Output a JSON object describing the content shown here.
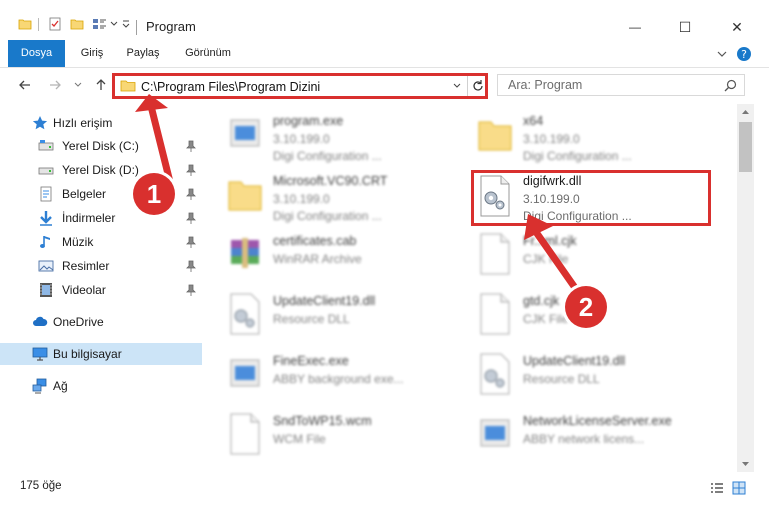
{
  "window": {
    "title": "Program",
    "minimize": "—",
    "maximize": "☐",
    "close": "✕"
  },
  "ribbon": {
    "tabs": [
      "Dosya",
      "Giriş",
      "Paylaş",
      "Görünüm"
    ]
  },
  "address": {
    "path": "C:\\Program Files\\Program Dizini",
    "search_placeholder": "Ara: Program"
  },
  "nav": {
    "quick_access": "Hızlı erişim",
    "items": [
      {
        "label": "Yerel Disk (C:)",
        "icon": "drive-icon",
        "pinned": true
      },
      {
        "label": "Yerel Disk (D:)",
        "icon": "drive-icon",
        "pinned": true
      },
      {
        "label": "Belgeler",
        "icon": "documents-icon",
        "pinned": true
      },
      {
        "label": "İndirmeler",
        "icon": "download-icon",
        "pinned": true
      },
      {
        "label": "Müzik",
        "icon": "music-icon",
        "pinned": true
      },
      {
        "label": "Resimler",
        "icon": "pictures-icon",
        "pinned": true
      },
      {
        "label": "Videolar",
        "icon": "videos-icon",
        "pinned": true
      }
    ],
    "onedrive": "OneDrive",
    "this_pc": "Bu bilgisayar",
    "network": "Ağ"
  },
  "files": [
    {
      "name": "program.exe",
      "line2": "3.10.199.0",
      "line3": "Digi Configuration ...",
      "icon": "exe-icon"
    },
    {
      "name": "x64",
      "line2": "3.10.199.0",
      "line3": "Digi Configuration ...",
      "icon": "folder-icon"
    },
    {
      "name": "Microsoft.VC90.CRT",
      "line2": "3.10.199.0",
      "line3": "Digi Configuration ...",
      "icon": "folder-icon"
    },
    {
      "name": "digifwrk.dll",
      "line2": "3.10.199.0",
      "line3": "Digi Configuration ...",
      "icon": "dll-gear-icon"
    },
    {
      "name": "certificates.cab",
      "line2": "WinRAR Archive",
      "line3": "",
      "icon": "archive-icon"
    },
    {
      "name": "Fr...ml.cjk",
      "line2": "CJK File",
      "line3": "",
      "icon": "file-icon"
    },
    {
      "name": "UpdateClient19.dll",
      "line2": "Resource DLL",
      "line3": "",
      "icon": "dll-gear-icon"
    },
    {
      "name": "gtd.cjk",
      "line2": "CJK File",
      "line3": "",
      "icon": "file-icon"
    },
    {
      "name": "FineExec.exe",
      "line2": "ABBY background exe...",
      "line3": "",
      "icon": "exe-icon"
    },
    {
      "name": "UpdateClient19.dll",
      "line2": "Resource DLL",
      "line3": "",
      "icon": "dll-gear-icon"
    },
    {
      "name": "SndToWP15.wcm",
      "line2": "WCM File",
      "line3": "",
      "icon": "file-icon"
    },
    {
      "name": "NetworkLicenseServer.exe",
      "line2": "ABBY network licens...",
      "line3": "",
      "icon": "exe-icon"
    }
  ],
  "status": {
    "count": "175 öğe"
  },
  "callouts": [
    "1",
    "2"
  ],
  "colors": {
    "accent": "#1979ca",
    "callout": "#d9302e",
    "selection": "#cce4f7"
  }
}
